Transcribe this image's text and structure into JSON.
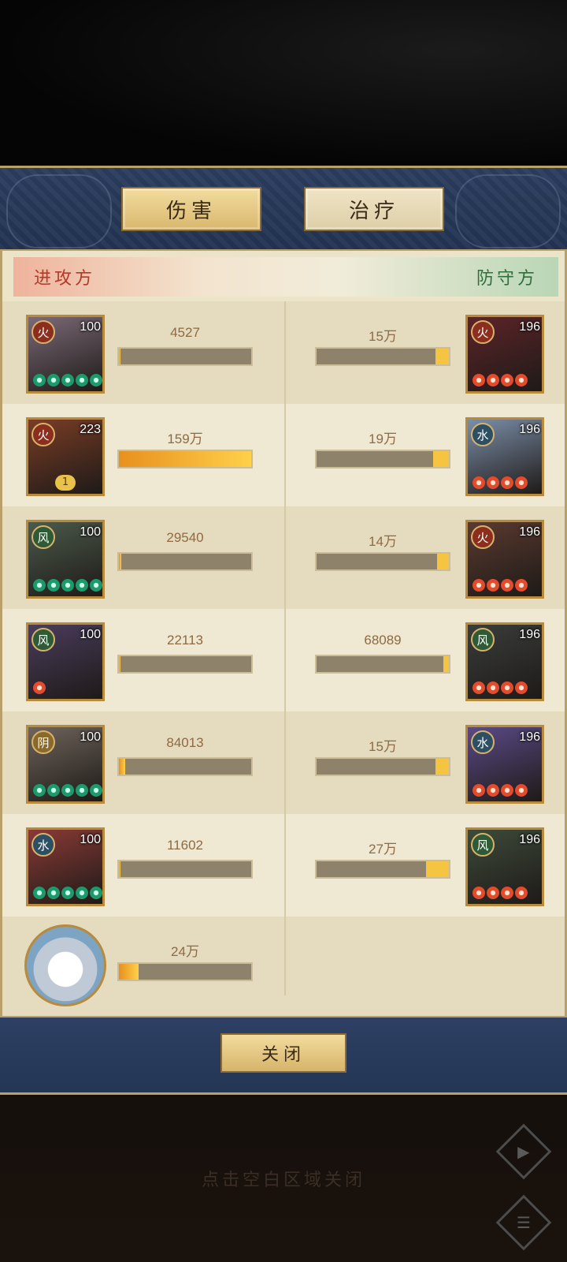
{
  "tabs": {
    "damage": "伤害",
    "healing": "治疗"
  },
  "sides": {
    "attack": "进攻方",
    "defense": "防守方"
  },
  "rows": [
    {
      "left": {
        "element": "火",
        "level": "100",
        "stars": 5,
        "star_color": "green",
        "value": "4527",
        "fill": 0.01,
        "bg": "#7b6a77"
      },
      "right": {
        "element": "火",
        "level": "196",
        "stars": 4,
        "star_color": "red",
        "value": "15万",
        "fill": 0.1,
        "bg": "#5d2428"
      }
    },
    {
      "left": {
        "element": "火",
        "level": "223",
        "stars": 0,
        "star_color": "green",
        "value": "159万",
        "fill": 1.0,
        "bg": "#7a3d25",
        "badge": "1"
      },
      "right": {
        "element": "水",
        "level": "196",
        "stars": 4,
        "star_color": "red",
        "value": "19万",
        "fill": 0.12,
        "bg": "#7b8ea8"
      }
    },
    {
      "left": {
        "element": "风",
        "level": "100",
        "stars": 5,
        "star_color": "green",
        "value": "29540",
        "fill": 0.02,
        "bg": "#4b5a4a"
      },
      "right": {
        "element": "火",
        "level": "196",
        "stars": 4,
        "star_color": "red",
        "value": "14万",
        "fill": 0.09,
        "bg": "#5a3a2f"
      }
    },
    {
      "left": {
        "element": "风",
        "level": "100",
        "stars": 1,
        "star_color": "red",
        "value": "22113",
        "fill": 0.01,
        "bg": "#4a3d5c"
      },
      "right": {
        "element": "风",
        "level": "196",
        "stars": 4,
        "star_color": "red",
        "value": "68089",
        "fill": 0.04,
        "bg": "#3a3d3a"
      }
    },
    {
      "left": {
        "element": "阴",
        "level": "100",
        "stars": 5,
        "star_color": "green",
        "value": "84013",
        "fill": 0.05,
        "bg": "#6e645a"
      },
      "right": {
        "element": "水",
        "level": "196",
        "stars": 4,
        "star_color": "red",
        "value": "15万",
        "fill": 0.1,
        "bg": "#5a4a86"
      }
    },
    {
      "left": {
        "element": "水",
        "level": "100",
        "stars": 5,
        "star_color": "green",
        "value": "11602",
        "fill": 0.01,
        "bg": "#8a3a35"
      },
      "right": {
        "element": "风",
        "level": "196",
        "stars": 4,
        "star_color": "red",
        "value": "27万",
        "fill": 0.17,
        "bg": "#3d4a3a"
      }
    }
  ],
  "pet": {
    "value": "24万",
    "fill": 0.15
  },
  "close_label": "关闭",
  "hint": "点击空白区域关闭",
  "colors": {
    "element": {
      "火": "#8b2e1d",
      "水": "#2d4f63",
      "风": "#2e5a35",
      "阴": "#8a6a2b"
    }
  }
}
